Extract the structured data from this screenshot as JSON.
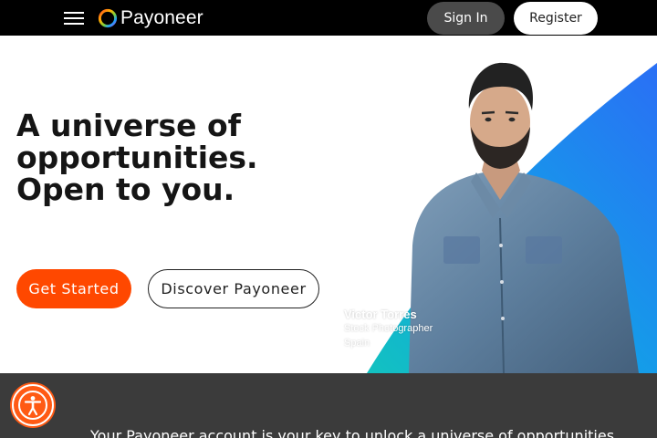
{
  "header": {
    "menu_icon": "hamburger-menu-icon",
    "logo_icon": "payoneer-ring-logo",
    "logo_text": "Payoneer",
    "signin_label": "Sign In",
    "register_label": "Register"
  },
  "hero": {
    "headline_line1": "A universe of",
    "headline_line2": "opportunities.",
    "headline_line3": "Open to you.",
    "get_started_label": "Get Started",
    "discover_label": "Discover Payoneer",
    "caption_name": "Victor Torres",
    "caption_role": "Stock Photographer",
    "caption_location": "Spain"
  },
  "section": {
    "tagline": "Your Payoneer account is your key to unlock a universe of opportunities."
  },
  "accessibility": {
    "icon": "accessibility-person-icon"
  },
  "colors": {
    "header_bg": "#000000",
    "primary_orange": "#ff4800",
    "signin_bg": "#4a4a4a",
    "dark_section_bg": "#3b3b3b",
    "hero_blue": "#1f8ff0",
    "hero_teal": "#12b8c8"
  }
}
